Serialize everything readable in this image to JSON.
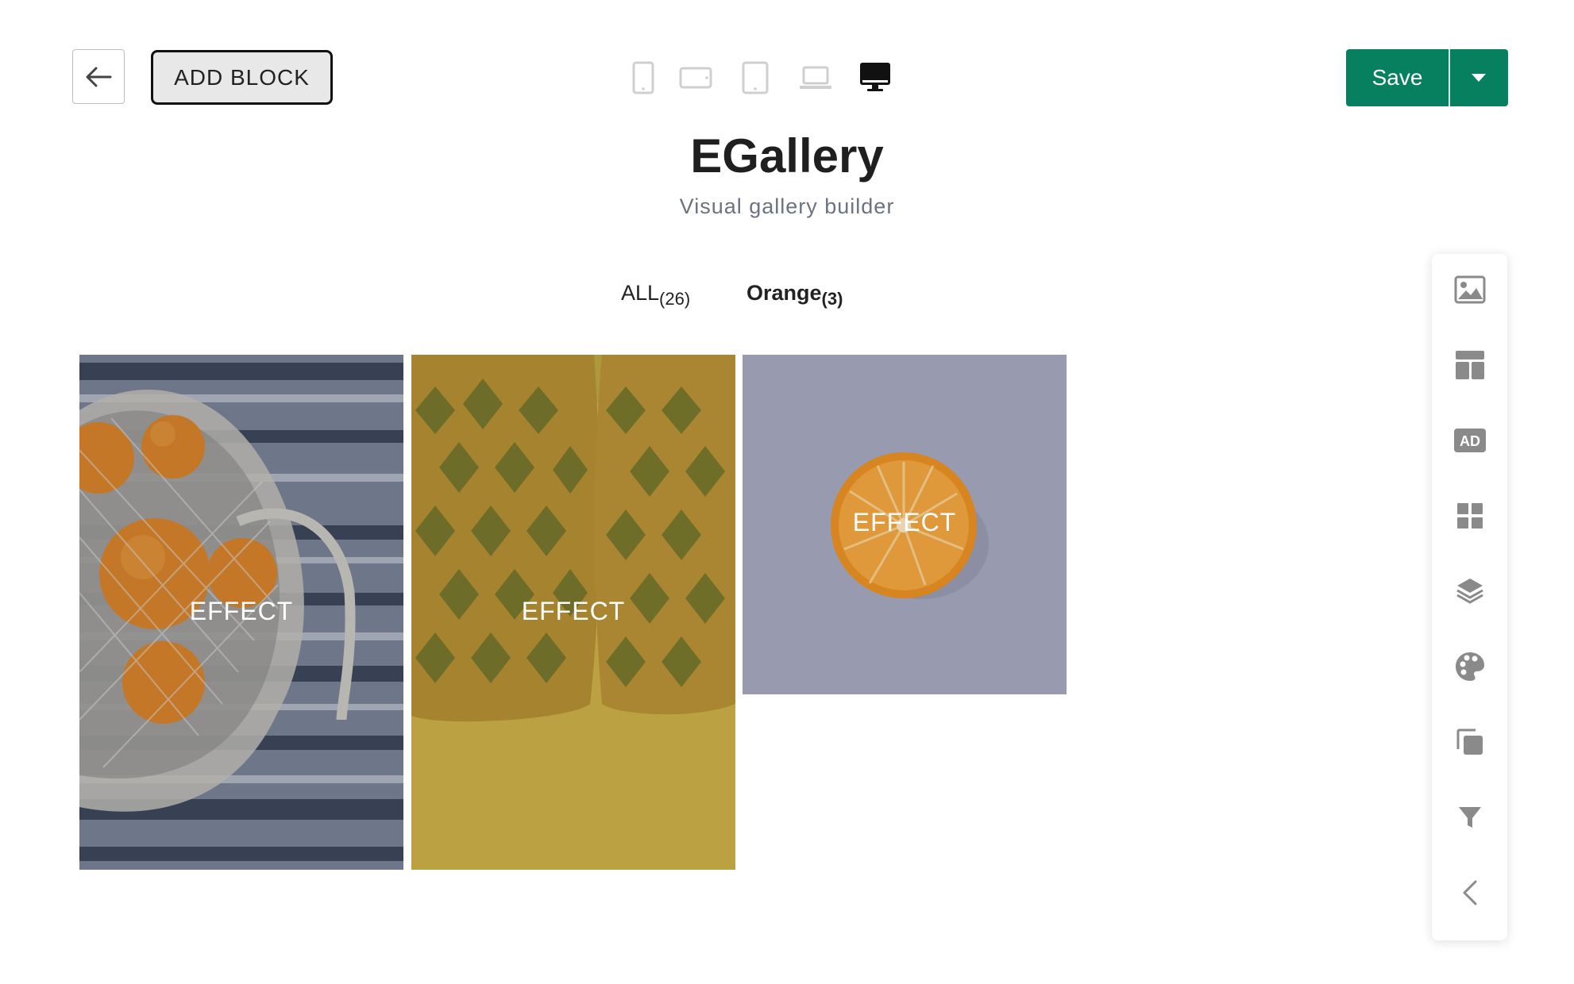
{
  "header": {
    "add_block_label": "ADD BLOCK",
    "save_label": "Save",
    "devices": [
      "mobile-icon",
      "mobile-landscape-icon",
      "tablet-icon",
      "laptop-icon",
      "desktop-icon"
    ],
    "active_device": "desktop-icon"
  },
  "page": {
    "title": "EGallery",
    "subtitle": "Visual gallery builder"
  },
  "filters": [
    {
      "label": "ALL",
      "count": "(26)",
      "active": false
    },
    {
      "label": "Orange",
      "count": "(3)",
      "active": true
    }
  ],
  "gallery": [
    {
      "alt": "oranges in mesh bag",
      "effect_label": "EFFECT"
    },
    {
      "alt": "pineapples on yellow",
      "effect_label": "EFFECT"
    },
    {
      "alt": "orange half on gray",
      "effect_label": "EFFECT"
    }
  ],
  "toolbar": {
    "items": [
      "image-icon",
      "layout-icon",
      "ad-icon",
      "grid-icon",
      "layers-icon",
      "palette-icon",
      "copy-icon",
      "filter-icon",
      "collapse-icon"
    ],
    "ad_text": "AD"
  },
  "colors": {
    "primary": "#07805f",
    "icon": "#8a8a8a",
    "active_icon": "#111111"
  }
}
